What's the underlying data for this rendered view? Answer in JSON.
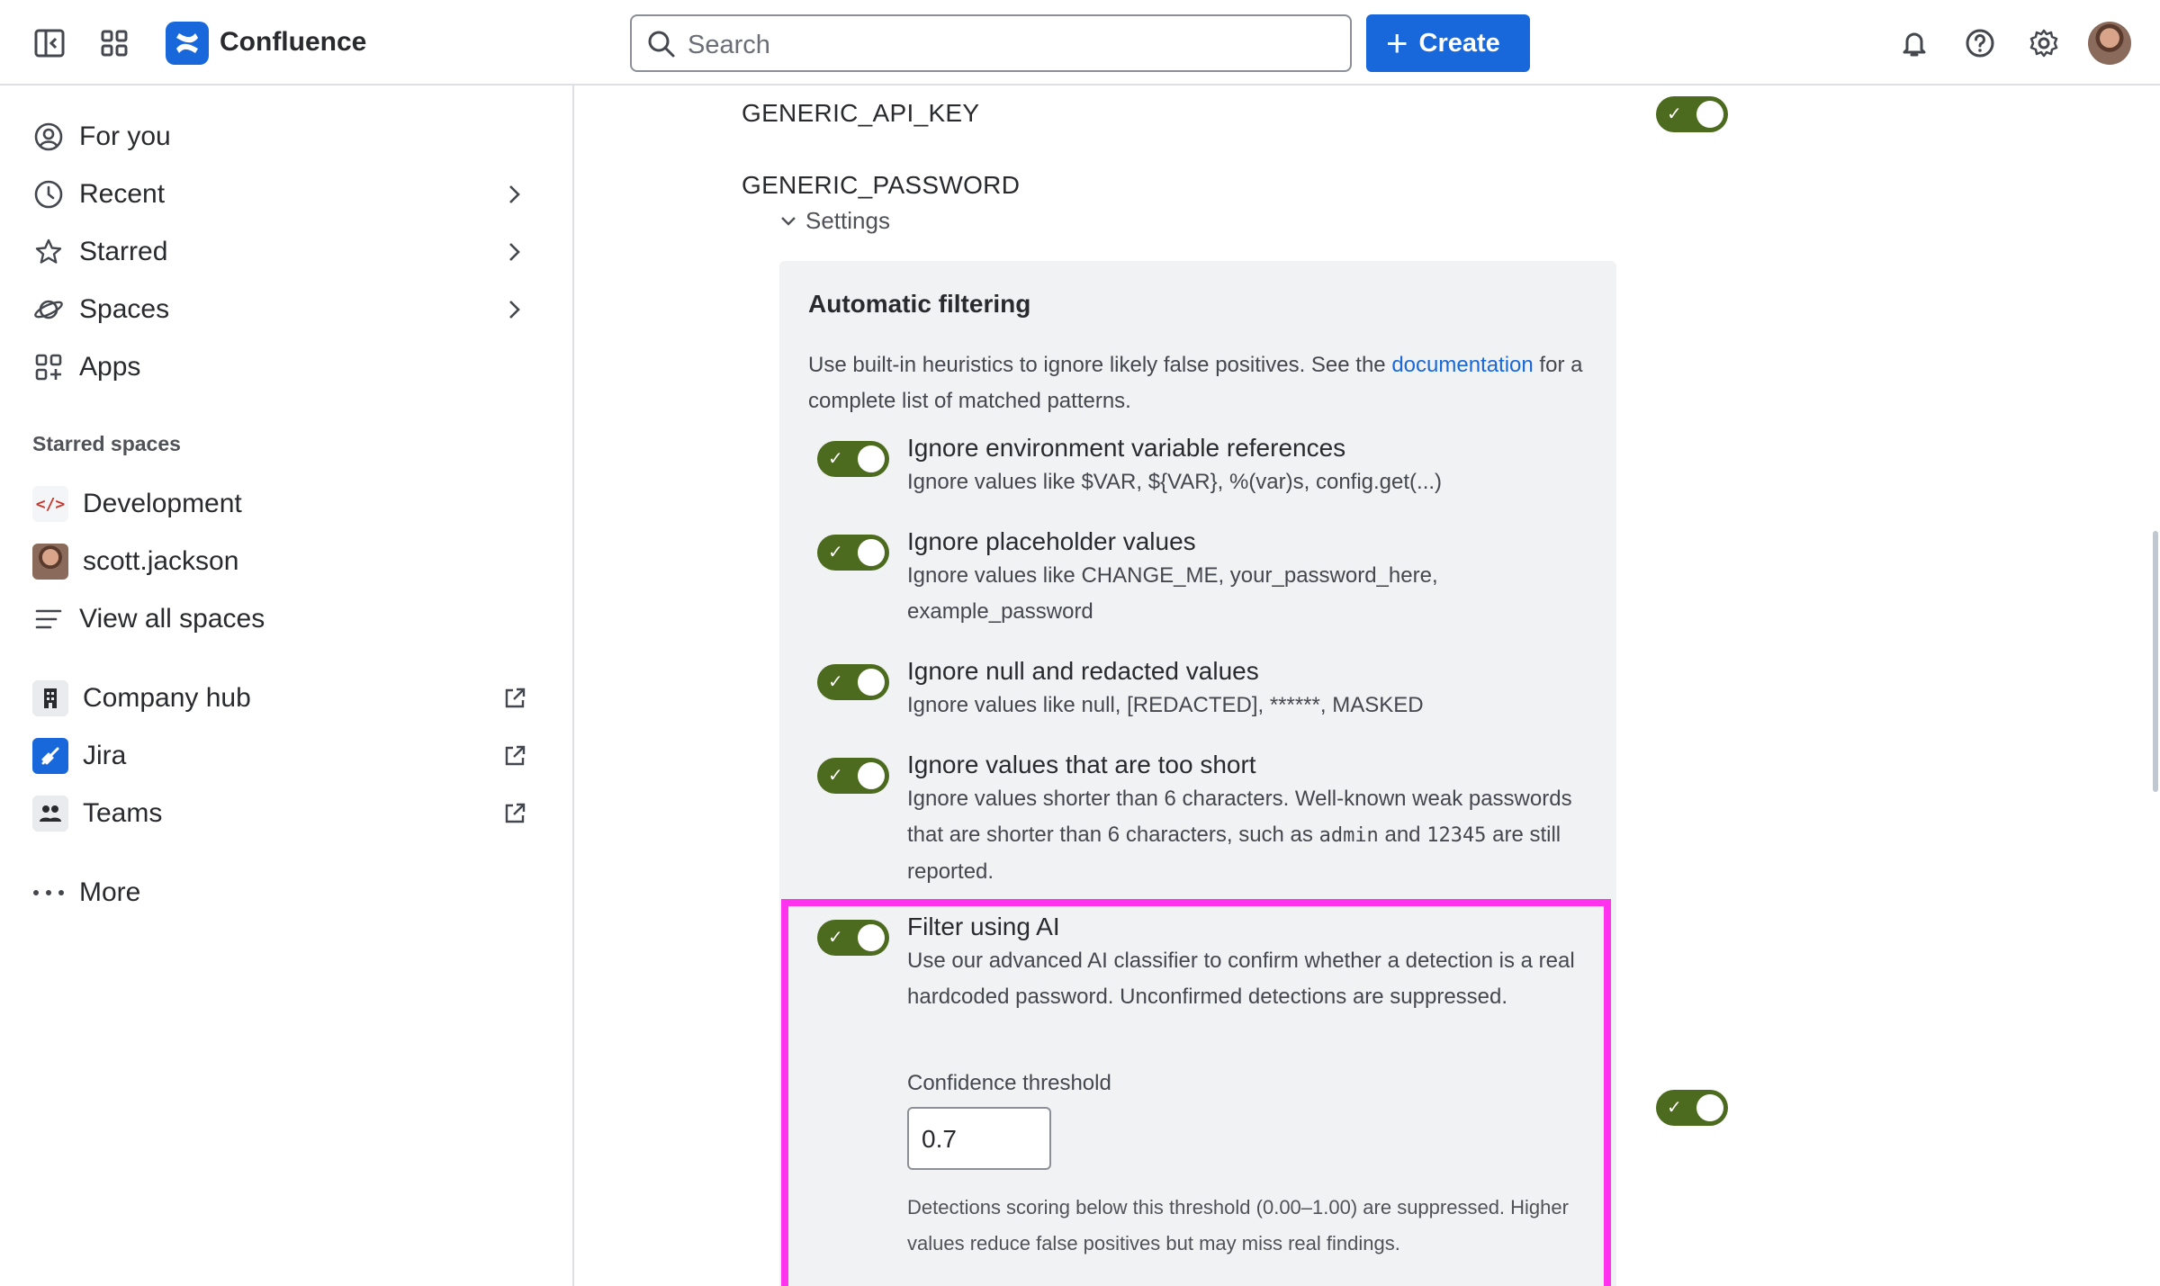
{
  "header": {
    "app_name": "Confluence",
    "search_placeholder": "Search",
    "create_label": "Create"
  },
  "sidebar": {
    "nav": [
      {
        "label": "For you"
      },
      {
        "label": "Recent"
      },
      {
        "label": "Starred"
      },
      {
        "label": "Spaces"
      },
      {
        "label": "Apps"
      }
    ],
    "starred_spaces_title": "Starred spaces",
    "starred_spaces": [
      {
        "label": "Development"
      },
      {
        "label": "scott.jackson"
      },
      {
        "label": "View all spaces"
      }
    ],
    "apps": [
      {
        "label": "Company hub"
      },
      {
        "label": "Jira"
      },
      {
        "label": "Teams"
      }
    ],
    "more_label": "More"
  },
  "main": {
    "keys": [
      {
        "label": "GENERIC_API_KEY",
        "enabled": true
      },
      {
        "label": "GENERIC_PASSWORD",
        "enabled": true
      }
    ],
    "settings_label": "Settings",
    "panel": {
      "title": "Automatic filtering",
      "desc_before": "Use built-in heuristics to ignore likely false positives. See the ",
      "desc_link": "documentation",
      "desc_after": " for a complete list of matched patterns.",
      "options": [
        {
          "title": "Ignore environment variable references",
          "desc": "Ignore values like $VAR, ${VAR}, %(var)s, config.get(...)",
          "enabled": true
        },
        {
          "title": "Ignore placeholder values",
          "desc": "Ignore values like CHANGE_ME, your_password_here, example_password",
          "enabled": true
        },
        {
          "title": "Ignore null and redacted values",
          "desc": "Ignore values like null, [REDACTED], ******, MASKED",
          "enabled": true
        },
        {
          "title": "Ignore values that are too short",
          "desc_a": "Ignore values shorter than 6 characters. Well-known weak passwords that are shorter than 6 characters, such as ",
          "code1": "admin",
          "desc_b": " and ",
          "code2": "12345",
          "desc_c": " are still reported.",
          "enabled": true
        },
        {
          "title": "Filter using AI",
          "desc": "Use our advanced AI classifier to confirm whether a detection is a real hardcoded password. Unconfirmed detections are suppressed.",
          "enabled": true
        }
      ],
      "threshold_label": "Confidence threshold",
      "threshold_value": "0.7",
      "threshold_help": "Detections scoring below this threshold (0.00–1.00) are suppressed. Higher values reduce false positives but may miss real findings."
    }
  },
  "colors": {
    "accent": "#1868db",
    "toggle_on": "#4c6b1f",
    "highlight": "#ff33ee"
  }
}
